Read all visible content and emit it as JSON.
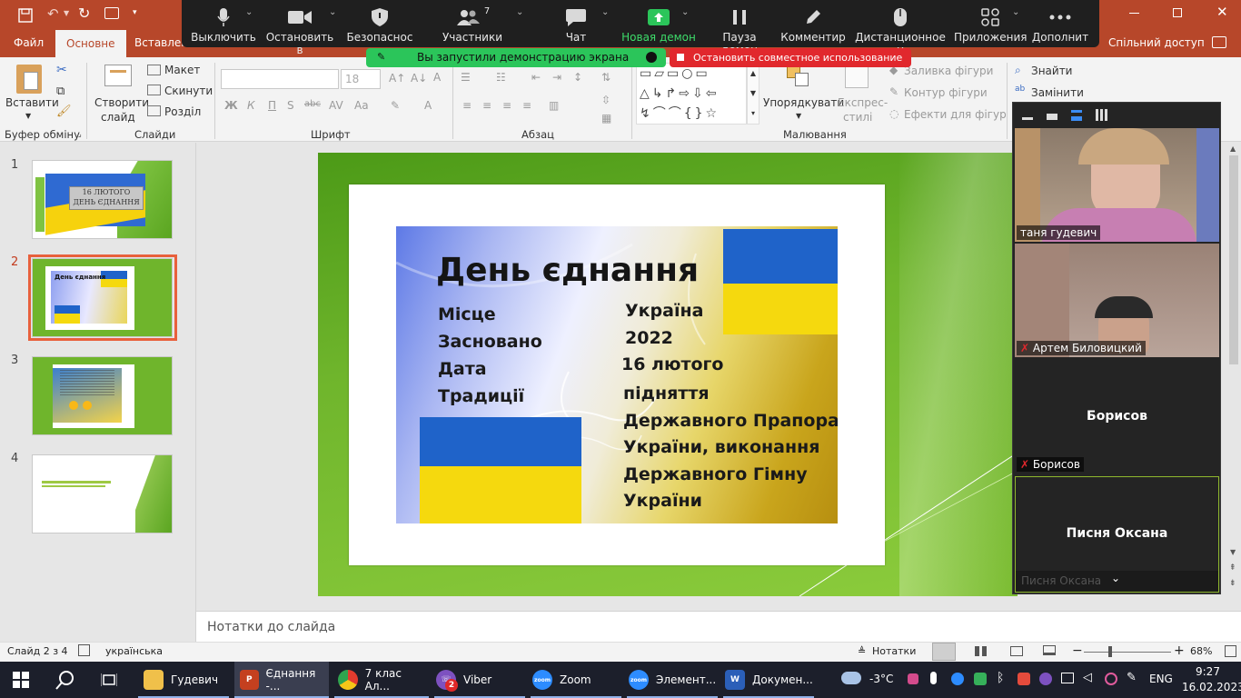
{
  "ppt": {
    "tabs": [
      "Файл",
      "Основне",
      "Вставлення"
    ],
    "share": "Спільний доступ",
    "ribbon": {
      "paste": "Вставити",
      "new_slide": [
        "Створити",
        "слайд"
      ],
      "layout": "Макет",
      "reset": "Скинути",
      "section": "Розділ",
      "font_size": "18",
      "arrange": "Упорядкувати",
      "quick_styles": [
        "Експрес-",
        "стилі"
      ],
      "shape_fill": "Заливка фігури",
      "shape_outline": "Контур фігури",
      "shape_effects": "Ефекти для фігур",
      "find": "Знайти",
      "replace": "Замінити",
      "groups": {
        "clipboard": "Буфер обміну",
        "slides": "Слайди",
        "font": "Шрифт",
        "paragraph": "Абзац",
        "drawing": "Малювання"
      }
    },
    "thumbnails": {
      "numbers": [
        "1",
        "2",
        "3",
        "4"
      ],
      "t1_text": [
        "16 ЛЮТОГО",
        "ДЕНЬ ЄДНАННЯ"
      ],
      "t2_title": "День єднання"
    },
    "slide": {
      "title": "День єднання",
      "labels": [
        "Місце",
        "Засновано",
        "Дата",
        "Традиції"
      ],
      "values": [
        "Україна",
        "2022",
        "16 лютого"
      ],
      "traditions": [
        "підняття",
        "Державного Прапора",
        "України, виконання",
        "Державного Гімну",
        "України"
      ]
    },
    "notes_placeholder": "Нотатки до слайда",
    "status": {
      "slide": "Слайд 2 з 4",
      "language": "українська",
      "notes": "Нотатки",
      "zoom": "68%"
    }
  },
  "zoom": {
    "toolbar": [
      {
        "label": "Выключить",
        "icon": "microphone-icon"
      },
      {
        "label": "Остановить в",
        "icon": "video-camera-icon"
      },
      {
        "label": "Безопаснос",
        "icon": "shield-icon"
      },
      {
        "label": "Участники",
        "icon": "participants-icon",
        "count": "7"
      },
      {
        "label": "Чат",
        "icon": "chat-icon"
      },
      {
        "label": "Новая демон",
        "icon": "share-screen-icon"
      },
      {
        "label": "Пауза демон",
        "icon": "pause-icon"
      },
      {
        "label": "Комментир",
        "icon": "annotate-pen-icon"
      },
      {
        "label": "Дистанционное у",
        "icon": "remote-control-icon"
      },
      {
        "label": "Приложения",
        "icon": "apps-icon"
      },
      {
        "label": "Дополнит",
        "icon": "more-icon"
      }
    ],
    "sharing_notice": "Вы запустили демонстрацию экрана",
    "stop_share": "Остановить совместное использование",
    "participants": [
      {
        "name": "таня гудевич",
        "muted": false
      },
      {
        "name": "Артем Биловицкий",
        "muted": true
      },
      {
        "name": "Борисов",
        "center": "Борисов",
        "muted": true
      },
      {
        "name": "Писня Оксана",
        "center": "Писня Оксана",
        "muted": true
      }
    ]
  },
  "taskbar": {
    "items": [
      {
        "label": "Гудевич",
        "icon": "folder-icon"
      },
      {
        "label": "Єднання -...",
        "icon": "powerpoint-icon"
      },
      {
        "label": "7 клас Ал...",
        "icon": "chrome-icon"
      },
      {
        "label": "Viber",
        "icon": "viber-icon",
        "badge": "2"
      },
      {
        "label": "Zoom",
        "icon": "zoom-icon"
      },
      {
        "label": "Элемент...",
        "icon": "zoom-icon"
      },
      {
        "label": "Докумен...",
        "icon": "word-icon"
      }
    ],
    "weather": "-3°C",
    "language": "ENG",
    "time": "9:27",
    "date": "16.02.2023"
  },
  "colors": {
    "ppt_accent": "#b7472a",
    "zoom_green": "#2bc55a",
    "zoom_red": "#e1282d",
    "slide_green": "#6fb52c",
    "flag_blue": "#1f63c9",
    "flag_yellow": "#f5d90e"
  }
}
